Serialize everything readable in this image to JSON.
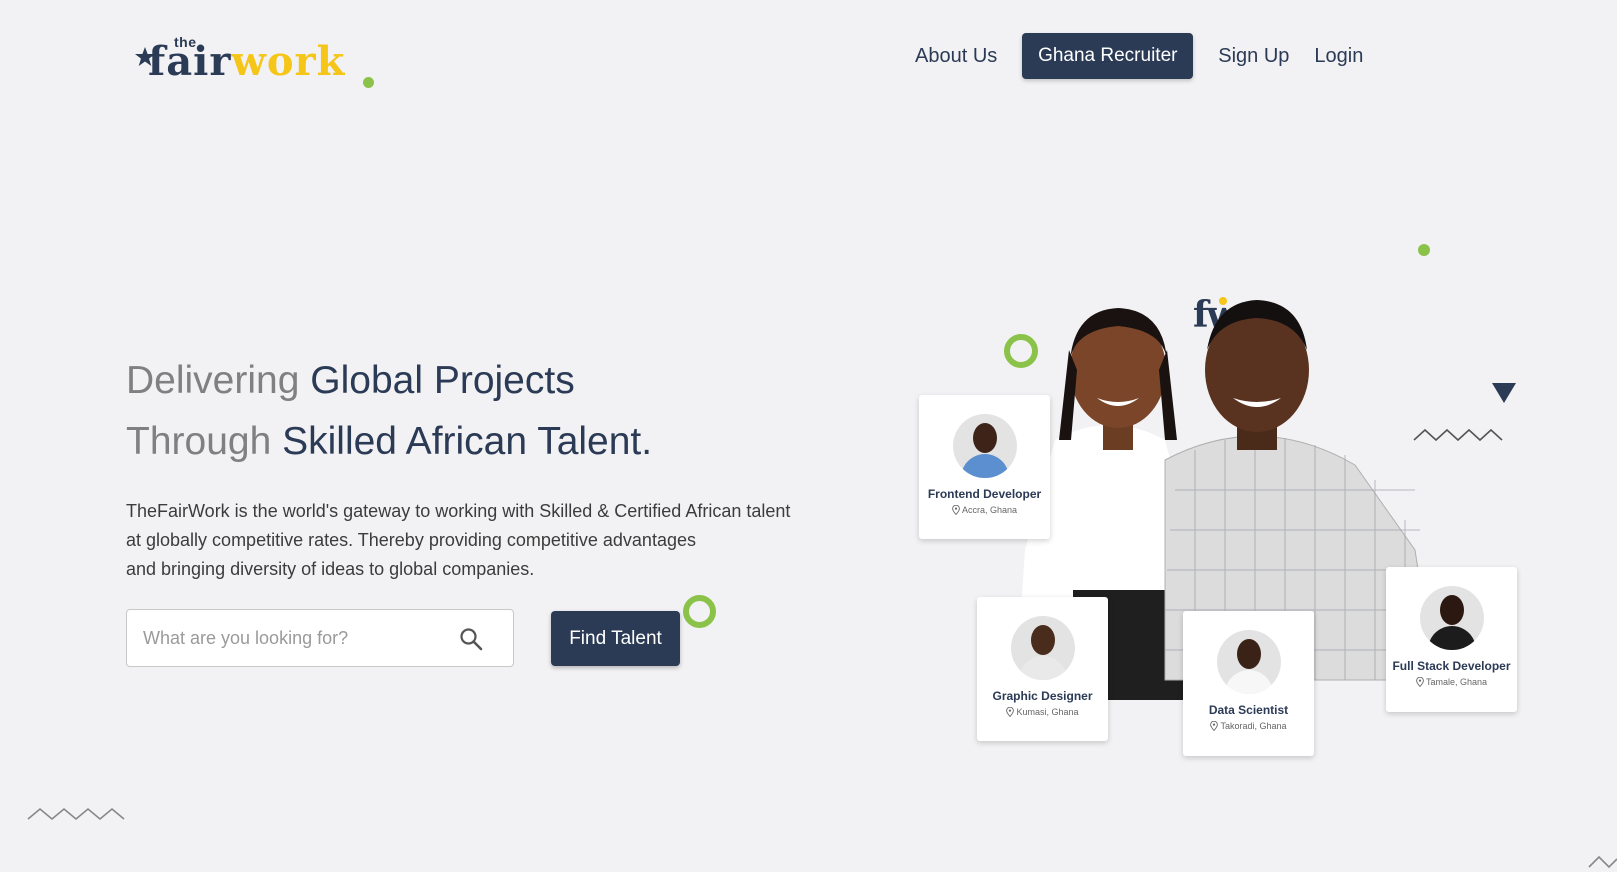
{
  "header": {
    "logo": {
      "small": "the",
      "fair": "fair",
      "work": "work"
    },
    "nav": {
      "about": "About Us",
      "recruiter": "Ghana Recruiter",
      "signup": "Sign Up",
      "login": "Login"
    }
  },
  "hero": {
    "line1_muted": "Delivering",
    "line1_dark": "Global Projects",
    "line2_muted": "Through",
    "line2_dark": "Skilled African Talent.",
    "description_1": "TheFairWork is the world's gateway to working with Skilled & Certified African talent",
    "description_2": "at globally competitive rates. Thereby providing competitive advantages",
    "description_3": "and bringing diversity of ideas to global companies.",
    "search_placeholder": "What are you looking for?",
    "search_value": "",
    "find_button": "Find Talent"
  },
  "illustration": {
    "brand_mark": "fw",
    "cards": [
      {
        "role": "Frontend Developer",
        "location": "Accra, Ghana"
      },
      {
        "role": "Graphic Designer",
        "location": "Kumasi, Ghana"
      },
      {
        "role": "Data Scientist",
        "location": "Takoradi, Ghana"
      },
      {
        "role": "Full Stack Developer",
        "location": "Tamale, Ghana"
      }
    ]
  },
  "colors": {
    "primary": "#2b3a55",
    "accent_yellow": "#f5c518",
    "accent_green": "#8bc34a",
    "background": "#f2f2f4"
  },
  "icons": [
    "star-icon",
    "search-icon",
    "location-pin-icon",
    "triangle-icon",
    "zigzag-icon"
  ]
}
